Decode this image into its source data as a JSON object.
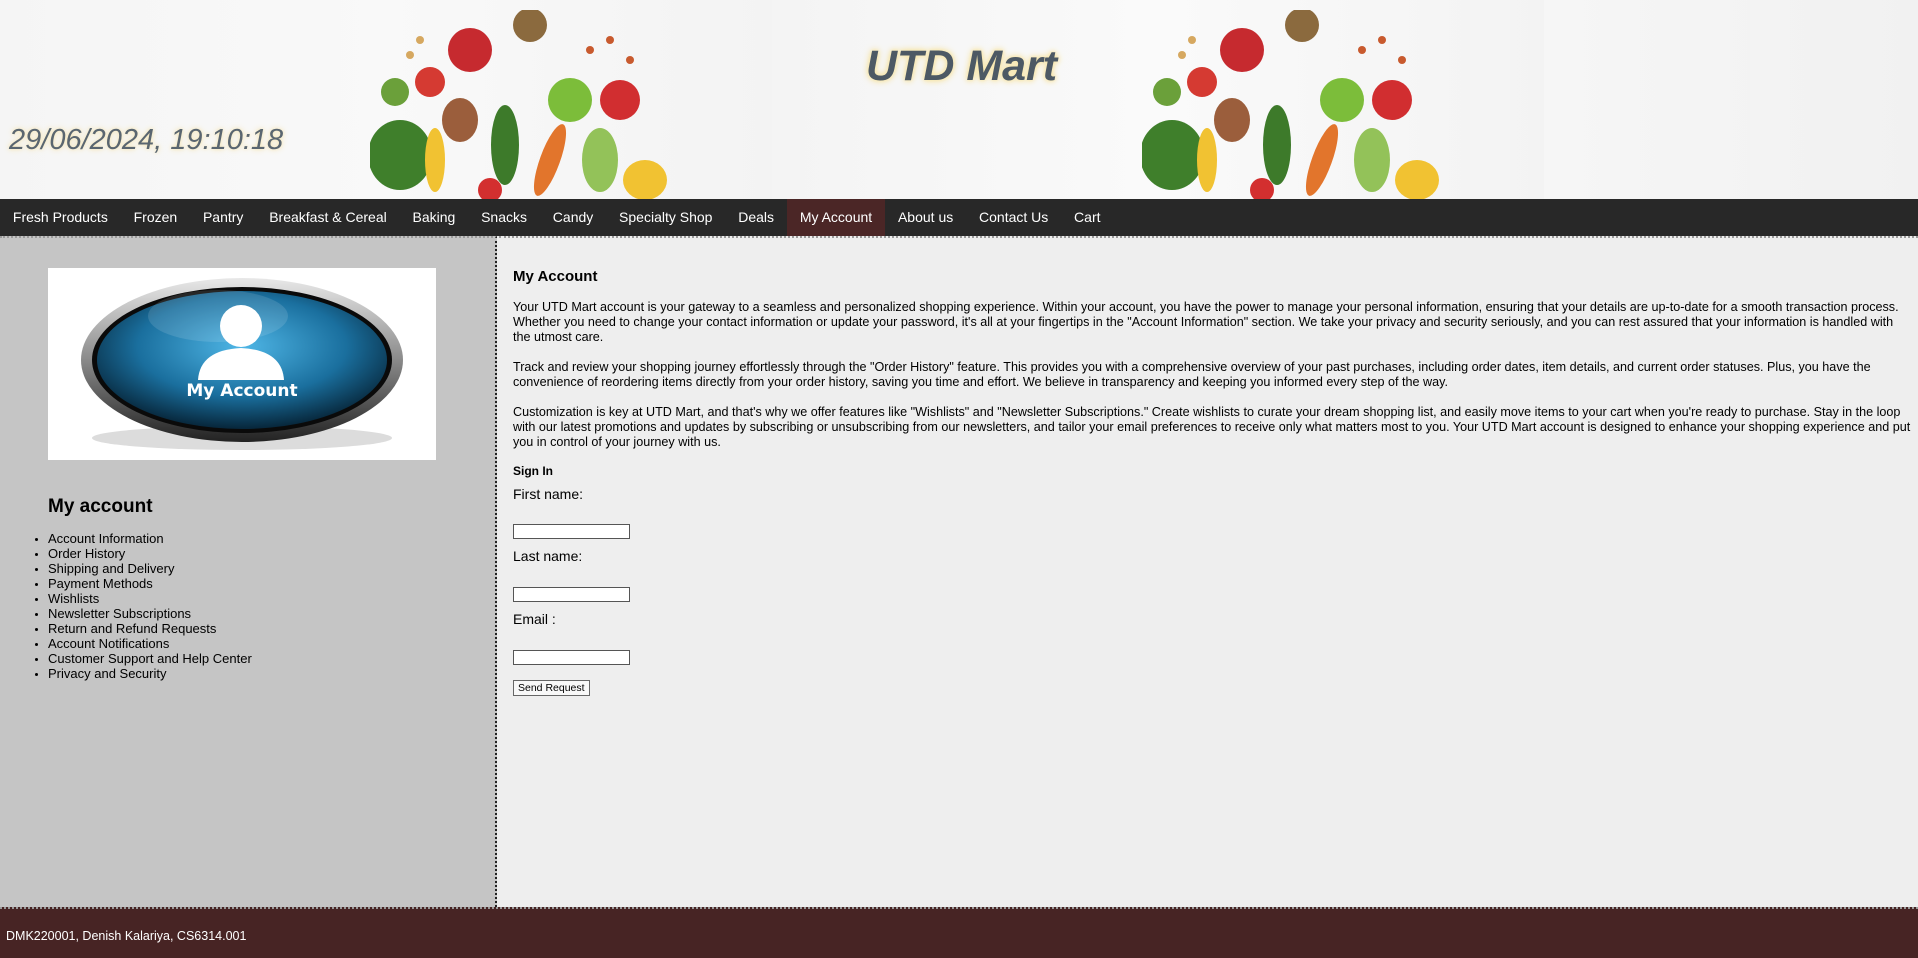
{
  "header": {
    "site_title": "UTD Mart",
    "clock_text": "29/06/2024, 19:10:18"
  },
  "nav": {
    "items": [
      {
        "label": "Fresh Products"
      },
      {
        "label": "Frozen"
      },
      {
        "label": "Pantry"
      },
      {
        "label": "Breakfast & Cereal"
      },
      {
        "label": "Baking"
      },
      {
        "label": "Snacks"
      },
      {
        "label": "Candy"
      },
      {
        "label": "Specialty Shop"
      },
      {
        "label": "Deals"
      },
      {
        "label": "My Account"
      },
      {
        "label": "About us"
      },
      {
        "label": "Contact Us"
      },
      {
        "label": "Cart"
      }
    ],
    "active_item": "My Account"
  },
  "sidebar": {
    "image_caption": "My Account",
    "heading": "My account",
    "links": [
      "Account Information",
      "Order History",
      "Shipping and Delivery",
      "Payment Methods",
      "Wishlists",
      "Newsletter Subscriptions",
      "Return and Refund Requests",
      "Account Notifications",
      "Customer Support and Help Center",
      "Privacy and Security"
    ]
  },
  "main": {
    "title": "My Account",
    "paragraphs": [
      "Your UTD Mart account is your gateway to a seamless and personalized shopping experience. Within your account, you have the power to manage your personal information, ensuring that your details are up-to-date for a smooth transaction process. Whether you need to change your contact information or update your password, it's all at your fingertips in the \"Account Information\" section. We take your privacy and security seriously, and you can rest assured that your information is handled with the utmost care.",
      "Track and review your shopping journey effortlessly through the \"Order History\" feature. This provides you with a comprehensive overview of your past purchases, including order dates, item details, and current order statuses. Plus, you have the convenience of reordering items directly from your order history, saving you time and effort. We believe in transparency and keeping you informed every step of the way.",
      "Customization is key at UTD Mart, and that's why we offer features like \"Wishlists\" and \"Newsletter Subscriptions.\" Create wishlists to curate your dream shopping list, and easily move items to your cart when you're ready to purchase. Stay in the loop with our latest promotions and updates by subscribing or unsubscribing from our newsletters, and tailor your email preferences to receive only what matters most to you. Your UTD Mart account is designed to enhance your shopping experience and put you in control of your journey with us."
    ],
    "signin": {
      "heading": "Sign In",
      "first_name_label": "First name:",
      "first_name_value": "",
      "last_name_label": "Last name:",
      "last_name_value": "",
      "email_label": "Email :",
      "email_value": "",
      "submit_label": "Send Request"
    }
  },
  "footer": {
    "text": "DMK220001, Denish Kalariya, CS6314.001"
  },
  "colors": {
    "nav_bg": "#282828",
    "nav_active": "#4b2626",
    "sidebar_bg": "#c5c5c5",
    "main_bg": "#eeeeee",
    "footer_bg": "#472424",
    "title_color": "#4d5964"
  }
}
